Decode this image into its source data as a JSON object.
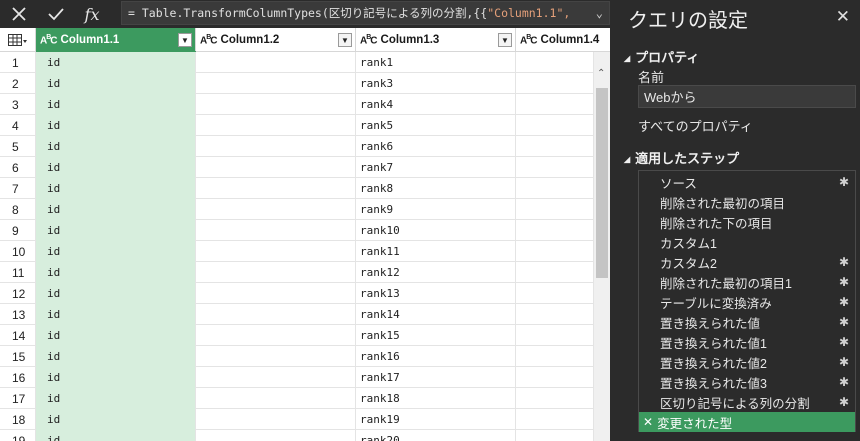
{
  "formula_bar": {
    "formula_prefix": "= Table.TransformColumnTypes(区切り記号による列の分割,{{",
    "formula_string": "\"Column1.1\","
  },
  "columns": [
    {
      "type_icon": "ABC",
      "name": "Column1.1",
      "selected": true
    },
    {
      "type_icon": "ABC",
      "name": "Column1.2",
      "selected": false
    },
    {
      "type_icon": "ABC",
      "name": "Column1.3",
      "selected": false
    },
    {
      "type_icon": "ABC",
      "name": "Column1.4",
      "selected": false
    }
  ],
  "rows": [
    {
      "n": "1",
      "c1": "id",
      "c2": "",
      "c3": "rank1",
      "c4": ""
    },
    {
      "n": "2",
      "c1": "id",
      "c2": "",
      "c3": "rank3",
      "c4": ""
    },
    {
      "n": "3",
      "c1": "id",
      "c2": "",
      "c3": "rank4",
      "c4": ""
    },
    {
      "n": "4",
      "c1": "id",
      "c2": "",
      "c3": "rank5",
      "c4": ""
    },
    {
      "n": "5",
      "c1": "id",
      "c2": "",
      "c3": "rank6",
      "c4": ""
    },
    {
      "n": "6",
      "c1": "id",
      "c2": "",
      "c3": "rank7",
      "c4": ""
    },
    {
      "n": "7",
      "c1": "id",
      "c2": "",
      "c3": "rank8",
      "c4": ""
    },
    {
      "n": "8",
      "c1": "id",
      "c2": "",
      "c3": "rank9",
      "c4": ""
    },
    {
      "n": "9",
      "c1": "id",
      "c2": "",
      "c3": "rank10",
      "c4": ""
    },
    {
      "n": "10",
      "c1": "id",
      "c2": "",
      "c3": "rank11",
      "c4": ""
    },
    {
      "n": "11",
      "c1": "id",
      "c2": "",
      "c3": "rank12",
      "c4": ""
    },
    {
      "n": "12",
      "c1": "id",
      "c2": "",
      "c3": "rank13",
      "c4": ""
    },
    {
      "n": "13",
      "c1": "id",
      "c2": "",
      "c3": "rank14",
      "c4": ""
    },
    {
      "n": "14",
      "c1": "id",
      "c2": "",
      "c3": "rank15",
      "c4": ""
    },
    {
      "n": "15",
      "c1": "id",
      "c2": "",
      "c3": "rank16",
      "c4": ""
    },
    {
      "n": "16",
      "c1": "id",
      "c2": "",
      "c3": "rank17",
      "c4": ""
    },
    {
      "n": "17",
      "c1": "id",
      "c2": "",
      "c3": "rank18",
      "c4": ""
    },
    {
      "n": "18",
      "c1": "id",
      "c2": "",
      "c3": "rank19",
      "c4": ""
    },
    {
      "n": "19",
      "c1": "id",
      "c2": "",
      "c3": "rank20",
      "c4": ""
    }
  ],
  "pane": {
    "title": "クエリの設定",
    "properties_header": "プロパティ",
    "name_label": "名前",
    "name_value": "Webから",
    "all_properties_link": "すべてのプロパティ",
    "steps_header": "適用したステップ",
    "steps": [
      {
        "label": "ソース",
        "gear": true,
        "active": false
      },
      {
        "label": "削除された最初の項目",
        "gear": false,
        "active": false
      },
      {
        "label": "削除された下の項目",
        "gear": false,
        "active": false
      },
      {
        "label": "カスタム1",
        "gear": false,
        "active": false
      },
      {
        "label": "カスタム2",
        "gear": true,
        "active": false
      },
      {
        "label": "削除された最初の項目1",
        "gear": true,
        "active": false
      },
      {
        "label": "テーブルに変換済み",
        "gear": true,
        "active": false
      },
      {
        "label": "置き換えられた値",
        "gear": true,
        "active": false
      },
      {
        "label": "置き換えられた値1",
        "gear": true,
        "active": false
      },
      {
        "label": "置き換えられた値2",
        "gear": true,
        "active": false
      },
      {
        "label": "置き換えられた値3",
        "gear": true,
        "active": false
      },
      {
        "label": "区切り記号による列の分割",
        "gear": true,
        "active": false
      },
      {
        "label": "変更された型",
        "gear": false,
        "active": true
      }
    ]
  },
  "colors": {
    "accent": "#3c9a5f",
    "selected_column_fill": "#d7eedd",
    "pane_bg": "#2b2b2b"
  }
}
